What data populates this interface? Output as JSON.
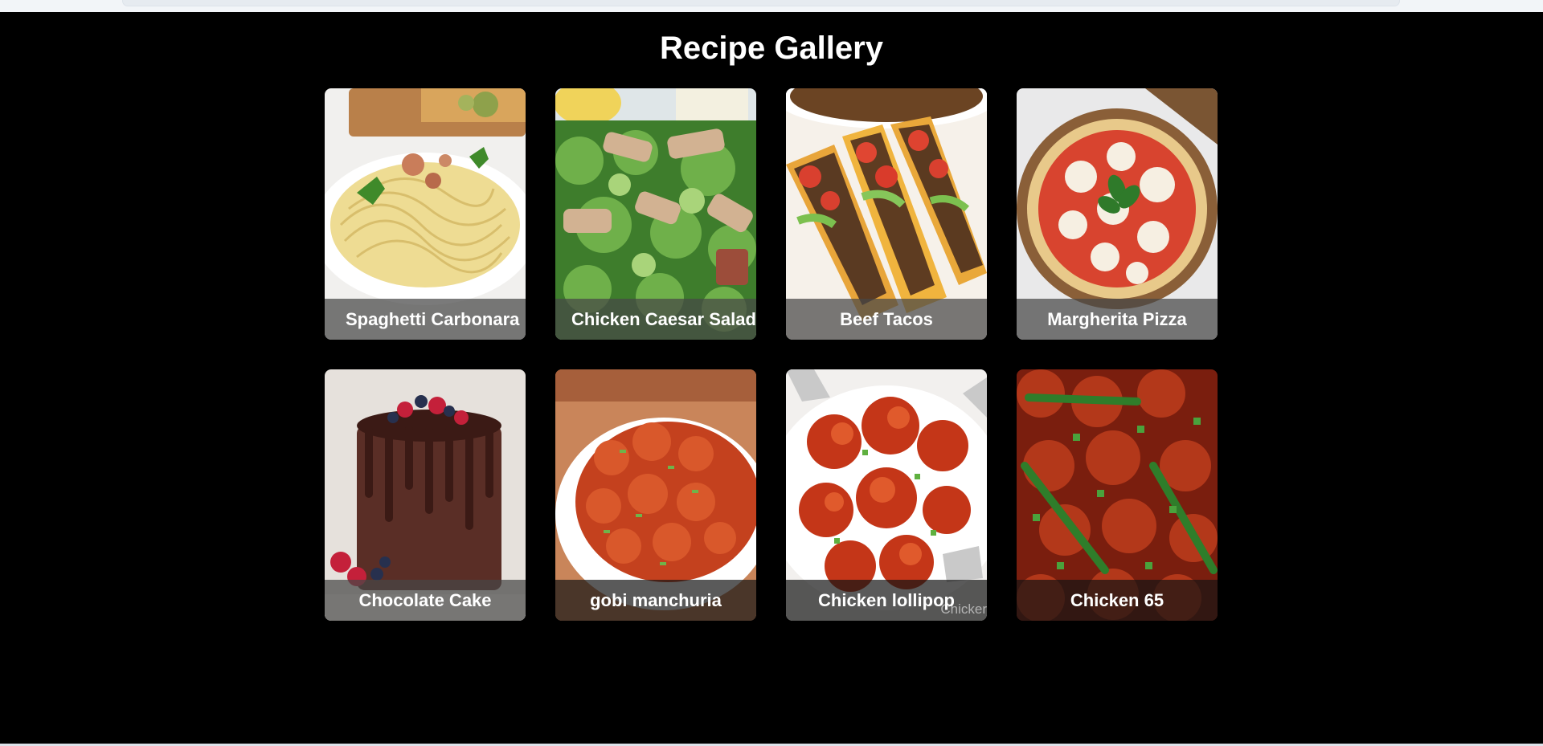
{
  "page": {
    "title": "Recipe Gallery"
  },
  "recipes": [
    {
      "name": "Spaghetti Carbonara",
      "image_icon": "spaghetti-plate"
    },
    {
      "name": "Chicken Caesar Salad",
      "image_icon": "caesar-salad-bowl"
    },
    {
      "name": "Beef Tacos",
      "image_icon": "beef-tacos"
    },
    {
      "name": "Margherita Pizza",
      "image_icon": "margherita-pizza"
    },
    {
      "name": "Chocolate Cake",
      "image_icon": "chocolate-drip-cake"
    },
    {
      "name": "gobi manchuria",
      "image_icon": "gobi-manchurian-bowl"
    },
    {
      "name": "Chicken lollipop",
      "image_icon": "chicken-lollipop-plate",
      "watermark": "Chicker"
    },
    {
      "name": "Chicken 65",
      "image_icon": "chicken-65-platter"
    }
  ],
  "colors": {
    "background": "#000000",
    "title": "#ffffff",
    "caption_bg": "rgba(70,70,70,0.72)"
  }
}
